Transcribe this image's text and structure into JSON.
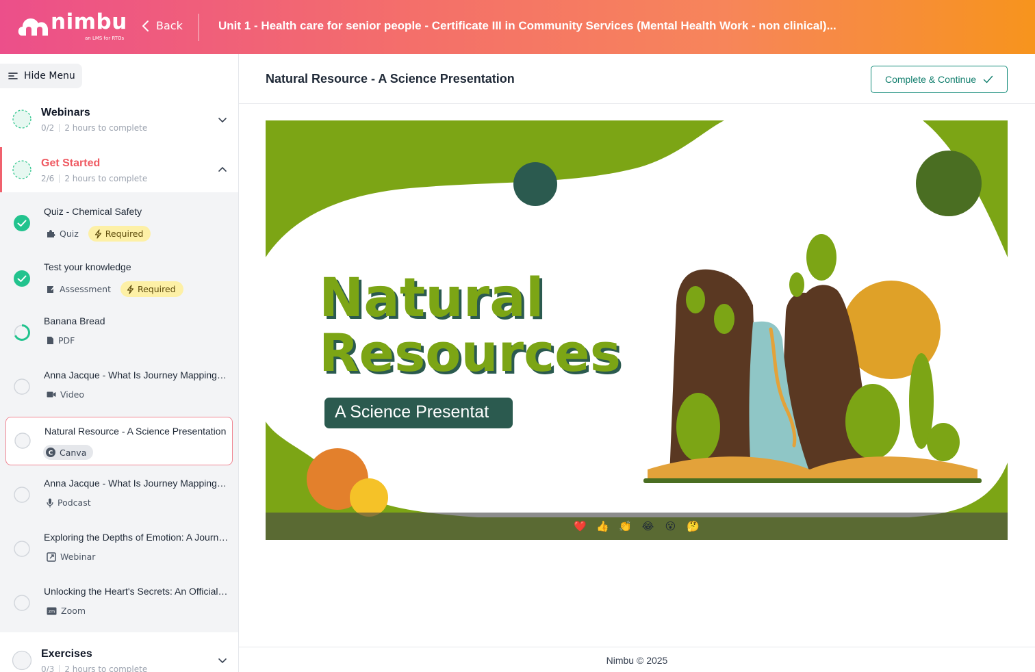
{
  "header": {
    "logo_text": "nimbu",
    "logo_tagline": "an LMS for RTOs",
    "back_label": "Back",
    "course_title": "Unit 1 - Health care for senior people - Certificate III in Community Services (Mental Health Work - non clinical)..."
  },
  "sidebar": {
    "hide_menu_label": "Hide Menu",
    "sections": [
      {
        "title": "Webinars",
        "progress": "0/2",
        "duration": "2 hours to complete",
        "expanded": false
      },
      {
        "title": "Get Started",
        "progress": "2/6",
        "duration": "2 hours to complete",
        "expanded": true
      },
      {
        "title": "Exercises",
        "progress": "0/3",
        "duration": "2 hours to complete",
        "expanded": false
      }
    ],
    "lessons": [
      {
        "title": "Quiz - Chemical Safety",
        "type": "Quiz",
        "icon": "puzzle-icon",
        "status": "complete",
        "required": "Required"
      },
      {
        "title": "Test your knowledge",
        "type": "Assessment",
        "icon": "edit-icon",
        "status": "complete",
        "required": "Required"
      },
      {
        "title": "Banana Bread",
        "type": "PDF",
        "icon": "file-icon",
        "status": "in-progress"
      },
      {
        "title": "Anna Jacque - What Is Journey Mapping? | Process, Benefits & Examples",
        "type": "Video",
        "icon": "video-icon",
        "status": "not-started"
      },
      {
        "title": "Natural Resource - A Science Presentation",
        "type": "Canva",
        "icon": "canva-icon",
        "status": "not-started",
        "current": true
      },
      {
        "title": "Anna Jacque - What Is Journey Mapping? | Process, Benefits & Examples",
        "type": "Podcast",
        "icon": "mic-icon",
        "status": "not-started"
      },
      {
        "title": "Exploring the Depths of Emotion: A Journey",
        "type": "Webinar",
        "icon": "webinar-icon",
        "status": "not-started"
      },
      {
        "title": "Unlocking the Heart's Secrets: An Official Session",
        "type": "Zoom",
        "icon": "zoom-icon",
        "status": "not-started"
      }
    ]
  },
  "main": {
    "page_title": "Natural Resource - A Science Presentation",
    "complete_button": "Complete & Continue",
    "slide": {
      "title_line1": "Natural",
      "title_line2": "Resources",
      "subtitle": "A Science Presentat"
    },
    "reactions": [
      "❤️",
      "👍",
      "👏",
      "😂",
      "😮",
      "🤔"
    ]
  },
  "footer": {
    "text": "Nimbu © 2025"
  },
  "colors": {
    "accent_pink": "#ec4f8a",
    "accent_orange": "#f7941d",
    "active_section": "#ef5a62",
    "complete_green": "#22c38e",
    "button_teal": "#0f7d6c",
    "slide_green": "#7ca515",
    "slide_dark_green": "#2b5a4f"
  }
}
